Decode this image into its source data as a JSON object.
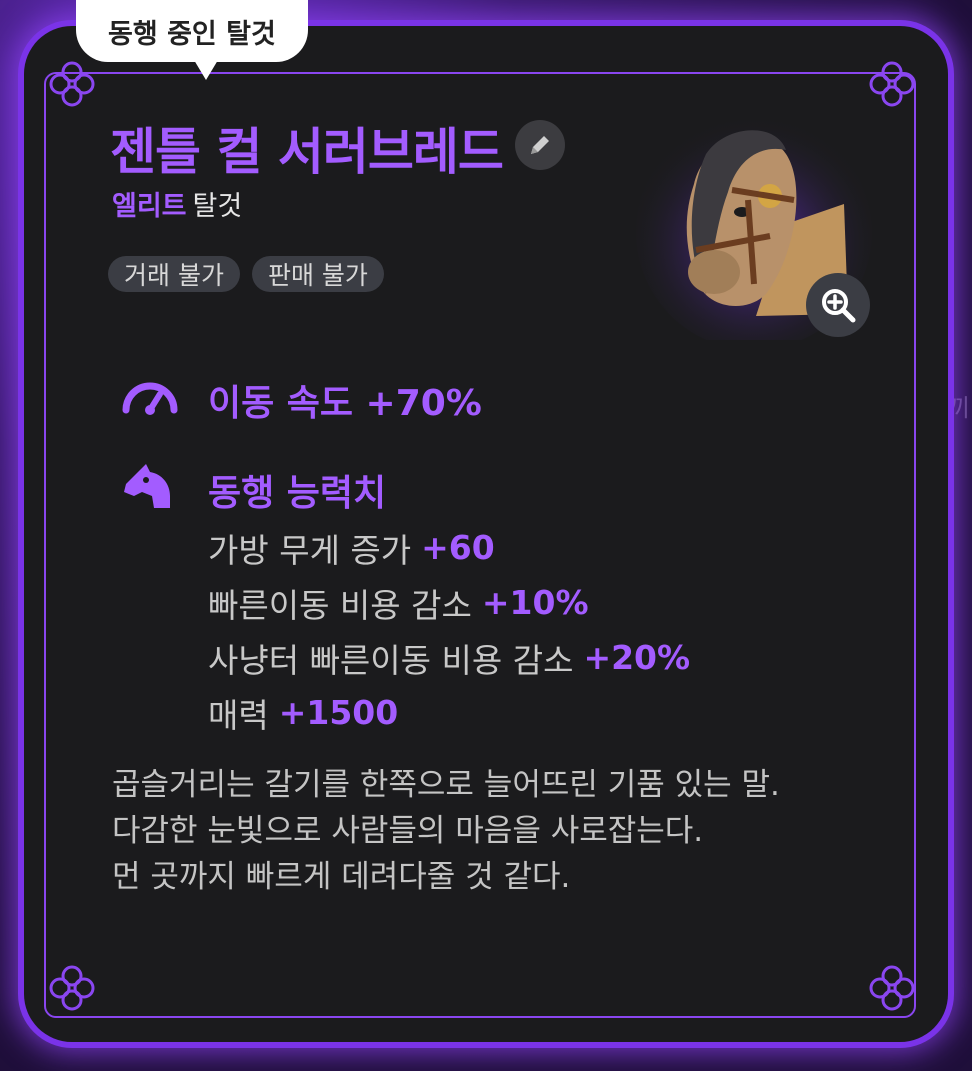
{
  "tab_label": "동행 중인 탈것",
  "mount": {
    "name": "젠틀 컬 서러브레드",
    "grade": "엘리트",
    "type": "탈것",
    "tags": [
      "거래 불가",
      "판매 불가"
    ]
  },
  "stats": {
    "speed_label": "이동 속도 +70%",
    "companion_title": "동행 능력치",
    "bonuses": [
      {
        "label": "가방 무게 증가",
        "value": "+60"
      },
      {
        "label": "빠른이동 비용 감소",
        "value": "+10%"
      },
      {
        "label": "사냥터 빠른이동 비용 감소",
        "value": "+20%"
      },
      {
        "label": "매력",
        "value": "+1500"
      }
    ]
  },
  "description": [
    "곱슬거리는 갈기를 한쪽으로 늘어뜨린 기품 있는 말.",
    "다감한 눈빛으로 사람들의 마음을 사로잡는다.",
    "먼 곳까지 빠르게 데려다줄 것 같다."
  ],
  "background_fragment": "끼",
  "colors": {
    "accent": "#a35cff",
    "frame": "#7a33e8",
    "card": "#1b1b1d"
  },
  "icons": {
    "edit": "pencil-icon",
    "zoom": "zoom-in-icon",
    "speed": "speedometer-icon",
    "companion": "horse-head-icon",
    "corner": "celtic-knot-icon"
  }
}
